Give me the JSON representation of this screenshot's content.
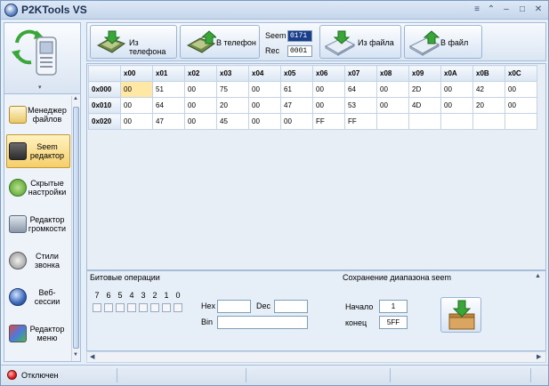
{
  "window": {
    "title": "P2KTools VS"
  },
  "titlebar_buttons": [
    "≡",
    "⌃",
    "–",
    "□",
    "✕"
  ],
  "nav": {
    "items": [
      {
        "label": "Менеджер файлов",
        "icon": "file-manager-icon",
        "active": false
      },
      {
        "label": "Seem редактор",
        "icon": "seem-editor-icon",
        "active": true
      },
      {
        "label": "Скрытые настройки",
        "icon": "hidden-settings-icon",
        "active": false
      },
      {
        "label": "Редактор громкости",
        "icon": "volume-editor-icon",
        "active": false
      },
      {
        "label": "Стили звонка",
        "icon": "ring-styles-icon",
        "active": false
      },
      {
        "label": "Веб-сессии",
        "icon": "web-sessions-icon",
        "active": false
      },
      {
        "label": "Редактор меню",
        "icon": "menu-editor-icon",
        "active": false
      }
    ]
  },
  "toolbar": {
    "from_phone": "Из телефона",
    "to_phone": "В телефон",
    "seem_label": "Seem",
    "seem_value": "0171",
    "rec_label": "Rec",
    "rec_value": "0001",
    "from_file": "Из файла",
    "to_file": "В файл"
  },
  "grid": {
    "columns": [
      "x00",
      "x01",
      "x02",
      "x03",
      "x04",
      "x05",
      "x06",
      "x07",
      "x08",
      "x09",
      "x0A",
      "x0B",
      "x0C"
    ],
    "rows": [
      {
        "label": "0x000",
        "cells": [
          "00",
          "51",
          "00",
          "75",
          "00",
          "61",
          "00",
          "64",
          "00",
          "2D",
          "00",
          "42",
          "00"
        ]
      },
      {
        "label": "0x010",
        "cells": [
          "00",
          "64",
          "00",
          "20",
          "00",
          "47",
          "00",
          "53",
          "00",
          "4D",
          "00",
          "20",
          "00"
        ]
      },
      {
        "label": "0x020",
        "cells": [
          "00",
          "47",
          "00",
          "45",
          "00",
          "00",
          "FF",
          "FF",
          "",
          "",
          "",
          "",
          ""
        ]
      }
    ]
  },
  "bit_ops": {
    "title": "Битовые операции",
    "bits": [
      "7",
      "6",
      "5",
      "4",
      "3",
      "2",
      "1",
      "0"
    ],
    "hex_label": "Hex",
    "dec_label": "Dec",
    "bin_label": "Bin",
    "hex_value": "",
    "dec_value": "",
    "bin_value": ""
  },
  "save_range": {
    "title": "Сохранение диапазона seem",
    "start_label": "Начало",
    "start_value": "1",
    "end_label": "конец",
    "end_value": "5FF"
  },
  "status": {
    "text": "Отключен",
    "led_color": "#e21c1c"
  }
}
